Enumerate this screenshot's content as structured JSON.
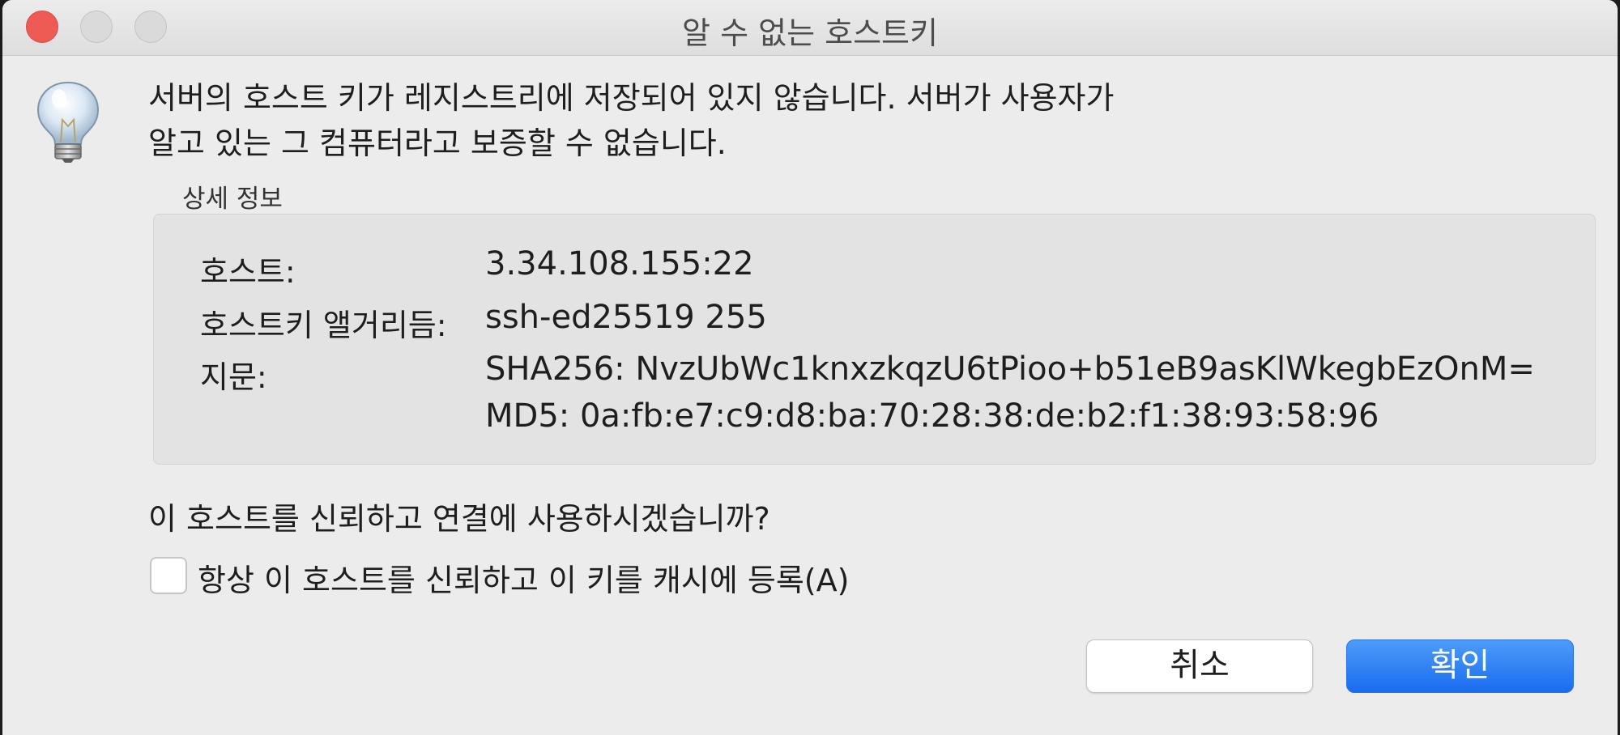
{
  "window": {
    "title": "알 수 없는 호스트키"
  },
  "message": {
    "line1": "서버의 호스트 키가 레지스트리에 저장되어 있지 않습니다. 서버가 사용자가",
    "line2": "알고 있는 그 컴퓨터라고 보증할 수 없습니다."
  },
  "details": {
    "group_label": "상세 정보",
    "host_label": "호스트:",
    "host_value": "3.34.108.155:22",
    "algorithm_label": "호스트키 앨거리듬:",
    "algorithm_value": "ssh-ed25519 255",
    "fingerprint_label": "지문:",
    "fingerprint_sha256": "SHA256: NvzUbWc1knxzkqzU6tPioo+b51eB9asKlWkegbEzOnM=",
    "fingerprint_md5": "MD5: 0a:fb:e7:c9:d8:ba:70:28:38:de:b2:f1:38:93:58:96"
  },
  "question": "이 호스트를 신뢰하고 연결에 사용하시겠습니까?",
  "checkbox": {
    "label": "항상 이 호스트를 신뢰하고 이 키를 캐시에 등록(A)",
    "checked": false
  },
  "buttons": {
    "cancel": "취소",
    "ok": "확인"
  },
  "icon": "lightbulb-icon",
  "colors": {
    "close_button": "#ee5b55",
    "primary_button": "#1a6cf0"
  }
}
